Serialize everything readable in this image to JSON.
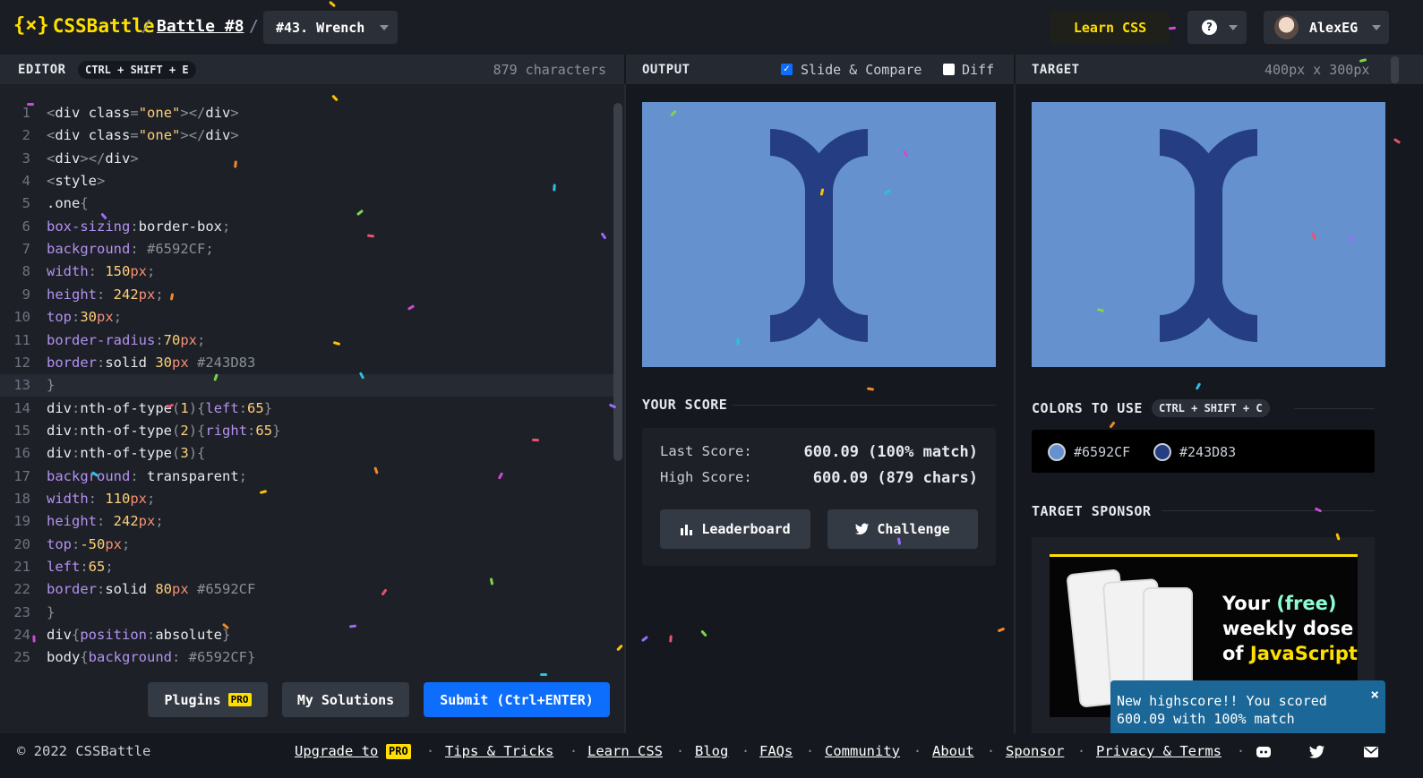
{
  "header": {
    "logo_mark": "{×}",
    "logo_text": "CSSBattle",
    "sep1": "/",
    "battle": "Battle #8",
    "sep2": "/",
    "target": "#43. Wrench",
    "learn": "Learn CSS",
    "help": "?",
    "user": "AlexEG"
  },
  "editor": {
    "title": "EDITOR",
    "shortcut": "CTRL + SHIFT + E",
    "chars": "879 characters",
    "lines": [
      {
        "n": "1"
      },
      {
        "n": "2"
      },
      {
        "n": "3"
      },
      {
        "n": "4"
      },
      {
        "n": "5"
      },
      {
        "n": "6"
      },
      {
        "n": "7"
      },
      {
        "n": "8"
      },
      {
        "n": "9"
      },
      {
        "n": "10"
      },
      {
        "n": "11"
      },
      {
        "n": "12"
      },
      {
        "n": "13"
      },
      {
        "n": "14"
      },
      {
        "n": "15"
      },
      {
        "n": "16"
      },
      {
        "n": "17"
      },
      {
        "n": "18"
      },
      {
        "n": "19"
      },
      {
        "n": "20"
      },
      {
        "n": "21"
      },
      {
        "n": "22"
      },
      {
        "n": "23"
      },
      {
        "n": "24"
      },
      {
        "n": "25"
      }
    ],
    "code": {
      "l1": [
        "<",
        "div",
        " ",
        "class",
        "=",
        "\"one\"",
        ">",
        "</",
        "div",
        ">"
      ],
      "l2": [
        "<",
        "div",
        " ",
        "class",
        "=",
        "\"one\"",
        ">",
        "</",
        "div",
        ">"
      ],
      "l3": [
        "<",
        "div",
        ">",
        "</",
        "div",
        ">"
      ],
      "l4": [
        "<",
        "style",
        ">"
      ],
      "l5": [
        ".one",
        "{"
      ],
      "l6": [
        "box-sizing",
        ":",
        "border-box",
        ";"
      ],
      "l7": [
        "background",
        ": ",
        "#6592CF",
        ";"
      ],
      "l8": [
        "width",
        ": ",
        "150",
        "px",
        ";"
      ],
      "l9": [
        "height",
        ": ",
        "242",
        "px",
        ";"
      ],
      "l10": [
        "top",
        ":",
        "30",
        "px",
        ";"
      ],
      "l11": [
        "border-radius",
        ":",
        "70",
        "px",
        ";"
      ],
      "l12": [
        "border",
        ":",
        "solid ",
        "30",
        "px",
        " #243D83"
      ],
      "l13": [
        "}"
      ],
      "l14": [
        "div",
        ":",
        "nth-of-type",
        "(",
        "1",
        ")",
        "{",
        "left",
        ":",
        "65",
        "}"
      ],
      "l15": [
        "div",
        ":",
        "nth-of-type",
        "(",
        "2",
        ")",
        "{",
        "right",
        ":",
        "65",
        "}"
      ],
      "l16": [
        "div",
        ":",
        "nth-of-type",
        "(",
        "3",
        ")",
        "{"
      ],
      "l17": [
        "background",
        ": ",
        "transparent",
        ";"
      ],
      "l18": [
        "width",
        ": ",
        "110",
        "px",
        ";"
      ],
      "l19": [
        "height",
        ": ",
        "242",
        "px",
        ";"
      ],
      "l20": [
        "top",
        ":",
        "-50",
        "px",
        ";"
      ],
      "l21": [
        "left",
        ":",
        "65",
        ";"
      ],
      "l22": [
        "border",
        ":",
        "solid ",
        "80",
        "px",
        " #6592CF"
      ],
      "l23": [
        "}"
      ],
      "l24": [
        "div",
        "{",
        "position",
        ":",
        "absolute",
        "}"
      ],
      "l25": [
        "body",
        "{",
        "background",
        ": ",
        "#6592CF",
        "}"
      ]
    },
    "plugins": "Plugins",
    "pro": "PRO",
    "my_solutions": "My Solutions",
    "submit": "Submit (Ctrl+ENTER)"
  },
  "output": {
    "title": "OUTPUT",
    "slide_compare": "Slide & Compare",
    "slide_checked": true,
    "diff": "Diff",
    "diff_checked": false
  },
  "target": {
    "title": "TARGET",
    "size": "400px x 300px"
  },
  "score": {
    "title": "YOUR SCORE",
    "last_label": "Last Score:",
    "last_value": "600.09 (100% match)",
    "high_label": "High Score:",
    "high_value": "600.09 (879 chars)",
    "leaderboard": "Leaderboard",
    "challenge": "Challenge"
  },
  "colors": {
    "title": "COLORS TO USE",
    "shortcut": "CTRL + SHIFT + C",
    "items": [
      {
        "hex": "#6592CF",
        "color": "#6592cf"
      },
      {
        "hex": "#243D83",
        "color": "#243d83"
      }
    ]
  },
  "sponsor": {
    "title": "TARGET SPONSOR",
    "line1a": "Your ",
    "line1b": "(free)",
    "line2": "weekly dose",
    "line3a": "of ",
    "line3b": "JavaScript"
  },
  "toast": {
    "text": "New highscore!! You scored 600.09 with 100% match",
    "close": "×"
  },
  "footer": {
    "copyright": "© 2022 CSSBattle",
    "upgrade": "Upgrade to",
    "pro": "PRO",
    "links": [
      "Tips & Tricks",
      "Learn CSS",
      "Blog",
      "FAQs",
      "Community",
      "About",
      "Sponsor",
      "Privacy & Terms"
    ],
    "dot": "·"
  },
  "palette": {
    "accent": "#ffdf00",
    "button_blue": "#0d6efd",
    "toast": "#1b6797"
  }
}
